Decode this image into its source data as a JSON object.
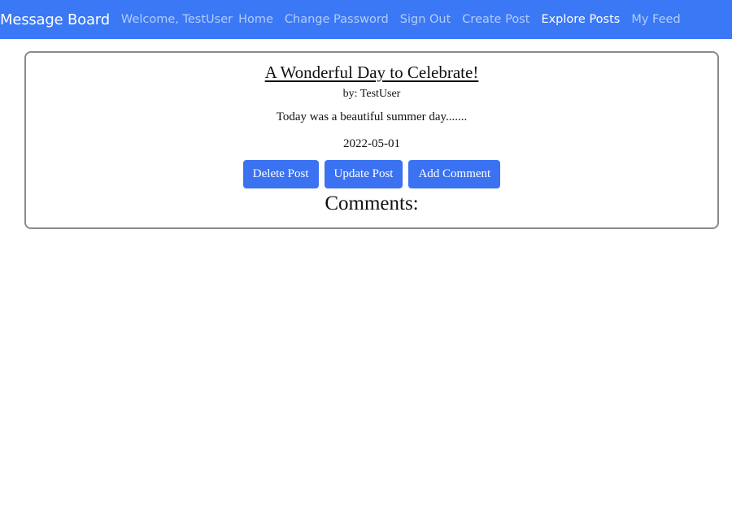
{
  "navbar": {
    "brand": "Message Board",
    "welcome": "Welcome, TestUser",
    "links": [
      {
        "label": "Home",
        "active": false
      },
      {
        "label": "Change Password",
        "active": false
      },
      {
        "label": "Sign Out",
        "active": false
      },
      {
        "label": "Create Post",
        "active": false
      },
      {
        "label": "Explore Posts",
        "active": true
      },
      {
        "label": "My Feed",
        "active": false
      }
    ],
    "color": "#3a78f5"
  },
  "post": {
    "title": "A Wonderful Day to Celebrate!",
    "author": "by: TestUser",
    "body": "Today was a beautiful summer day.......",
    "date": "2022-05-01",
    "buttons": {
      "delete": "Delete Post",
      "update": "Update Post",
      "comment": "Add Comment"
    },
    "comments_heading": "Comments:"
  },
  "colors": {
    "accent": "#3a72f2",
    "card_border": "#8a8a8a"
  }
}
